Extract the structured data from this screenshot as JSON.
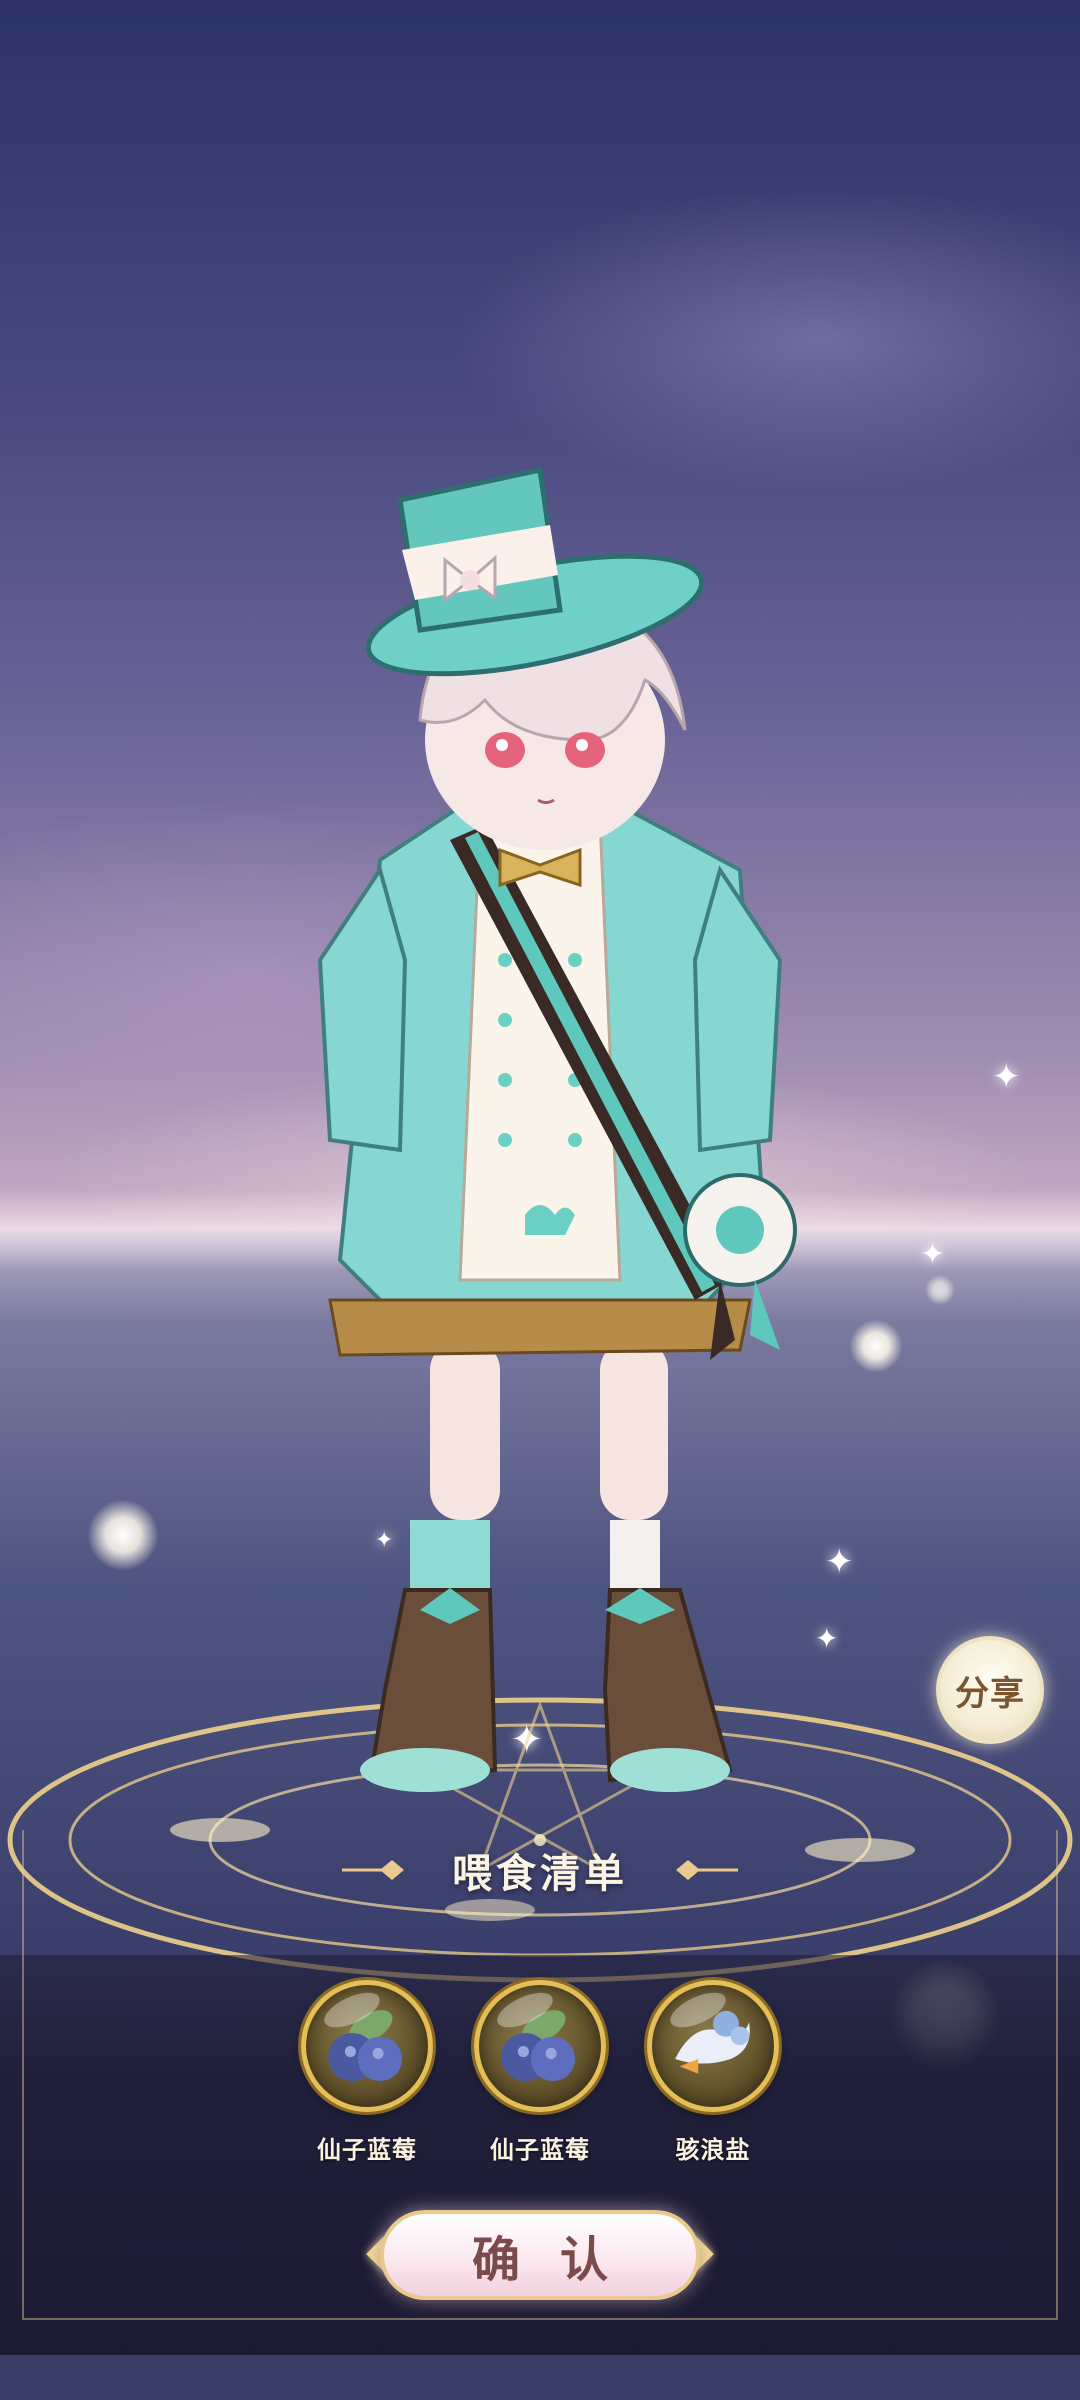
{
  "share": {
    "label": "分享"
  },
  "feed_panel": {
    "title": "喂食清单",
    "items": [
      {
        "name": "仙子蓝莓",
        "icon": "fairy-blueberry-icon"
      },
      {
        "name": "仙子蓝莓",
        "icon": "fairy-blueberry-icon"
      },
      {
        "name": "骇浪盐",
        "icon": "wave-salt-icon"
      }
    ]
  },
  "confirm": {
    "label": "确认"
  },
  "colors": {
    "accent_gold": "#e6be57",
    "outfit_teal": "#7fd3cf",
    "panel_bg": "#1e1c34",
    "confirm_text": "#7b4a4a"
  }
}
